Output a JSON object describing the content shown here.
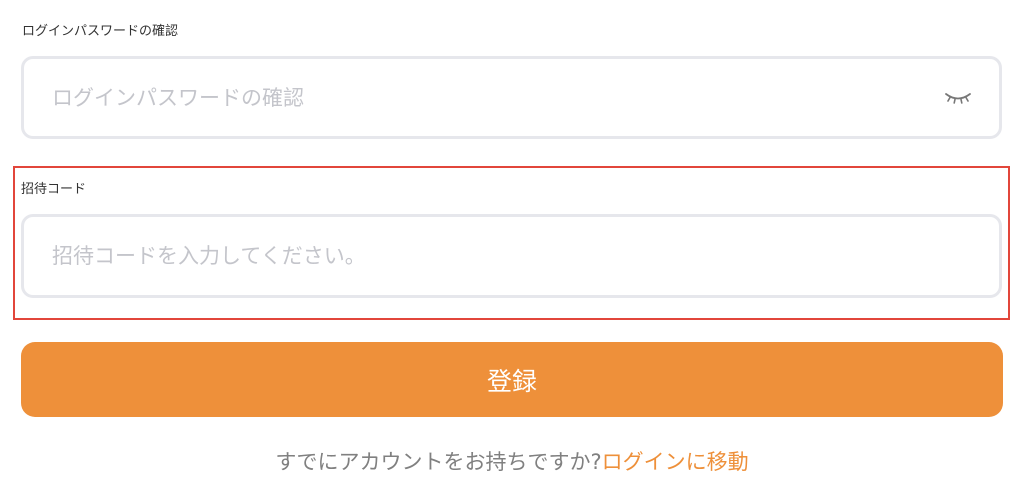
{
  "password_confirm": {
    "label": "ログインパスワードの確認",
    "placeholder": "ログインパスワードの確認",
    "value": "",
    "toggle_icon": "eye-closed-icon"
  },
  "invite_code": {
    "label": "招待コード",
    "placeholder": "招待コードを入力してください。",
    "value": ""
  },
  "submit": {
    "label": "登録"
  },
  "footer": {
    "text": "すでにアカウントをお持ちですか?",
    "link": "ログインに移動"
  },
  "colors": {
    "accent": "#ee903a",
    "highlight_border": "#e2463b",
    "input_border": "#e6e7ec",
    "placeholder": "#c4c5cb",
    "muted_text": "#808080"
  }
}
